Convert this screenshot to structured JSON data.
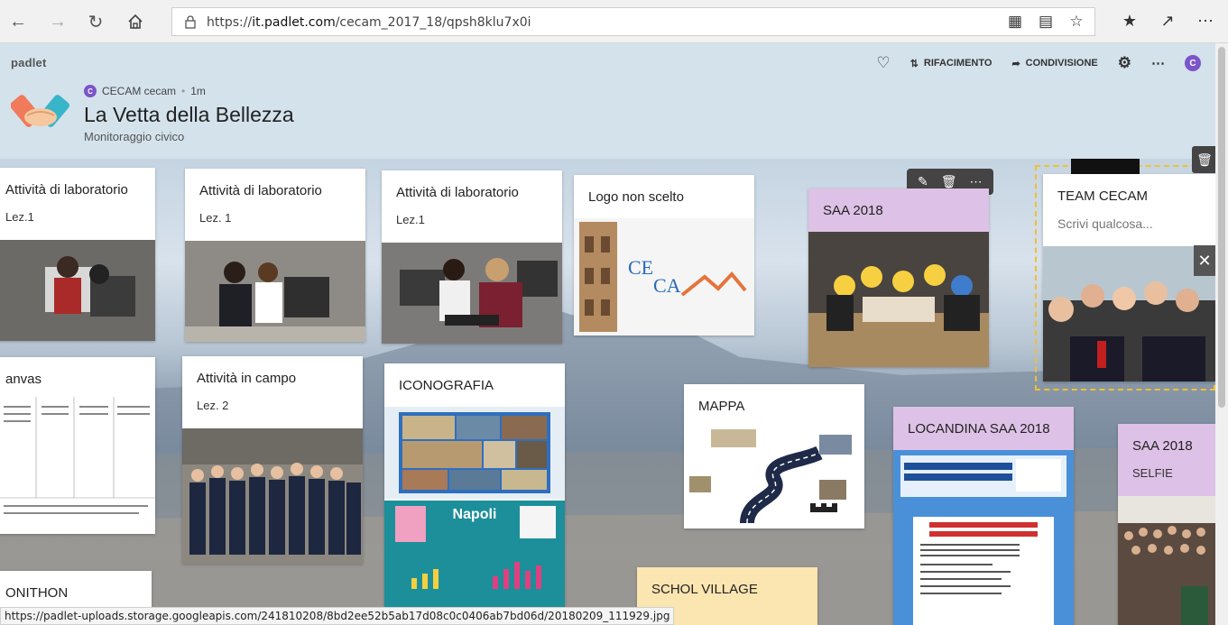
{
  "browser": {
    "url_scheme": "https://",
    "url_host": "it.padlet.com",
    "url_path": "/cecam_2017_18/qpsh8klu7x0i",
    "status_url": "https://padlet-uploads.storage.googleapis.com/241810208/8bd2ee52b5ab17d08c0c0406ab7bd06d/20180209_111929.jpg"
  },
  "header": {
    "brand": "padlet",
    "remake_label": "RIFACIMENTO",
    "share_label": "CONDIVISIONE",
    "user_initial": "C",
    "author_name": "CECAM cecam",
    "author_initial": "C",
    "time_ago": "1m",
    "title": "La Vetta della Bellezza",
    "subtitle": "Monitoraggio civico"
  },
  "cards": [
    {
      "id": "c1",
      "title": "Attività di laboratorio",
      "body": "Lez.1"
    },
    {
      "id": "c2",
      "title": "Attività di laboratorio",
      "body": "Lez. 1"
    },
    {
      "id": "c3",
      "title": "Attività di laboratorio",
      "body": "Lez.1"
    },
    {
      "id": "c4",
      "title": "Logo non scelto",
      "body": ""
    },
    {
      "id": "c5",
      "title": "SAA 2018",
      "body": ""
    },
    {
      "id": "c6",
      "title": "TEAM CECAM",
      "body": "Scrivi qualcosa..."
    },
    {
      "id": "c7",
      "title": "anvas",
      "body": ""
    },
    {
      "id": "c8",
      "title": "Attività in campo",
      "body": "Lez. 2"
    },
    {
      "id": "c9",
      "title": "ICONOGRAFIA",
      "body": ""
    },
    {
      "id": "c10",
      "title": "MAPPA",
      "body": ""
    },
    {
      "id": "c11",
      "title": "LOCANDINA SAA 2018",
      "body": ""
    },
    {
      "id": "c12",
      "title": "SAA 2018",
      "body": "SELFIE"
    },
    {
      "id": "c13",
      "title": "ONITHON",
      "body": ""
    },
    {
      "id": "c14",
      "title": "SCHOL VILLAGE",
      "body": ""
    }
  ],
  "logo_text": {
    "line1": "CE",
    "line2": "CA"
  },
  "napoli_graphic": {
    "title": "Napoli"
  },
  "colors": {
    "accent_purple": "#7b54c9",
    "card_purple": "#ddc1e6",
    "card_orange": "#fde4c6",
    "selection": "#f0c030"
  }
}
